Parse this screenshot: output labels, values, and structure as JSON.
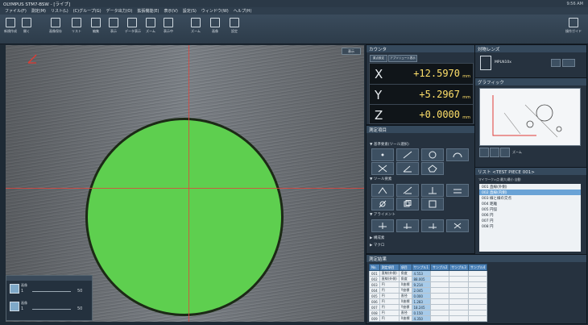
{
  "window": {
    "title": "OLYMPUS STM7-BSW - [ライブ]",
    "clock": "9:56 AM"
  },
  "menu": [
    "ファイル(F)",
    "測定(M)",
    "リスト(L)",
    "(C)グループ(G)",
    "データ出力(O)",
    "拡張機能(E)",
    "表示(V)",
    "設定(S)",
    "ウィンドウ(W)",
    "ヘルプ(H)"
  ],
  "toolbar": {
    "left_tools": [
      "新規作成",
      "開く",
      "画像保存",
      "リスト",
      "編集",
      "表示",
      "データ表示",
      "ズーム",
      "表示中",
      "ズーム",
      "画像",
      "設定"
    ],
    "right_label": "操作ガイド"
  },
  "live": {
    "corner_button": "表示"
  },
  "mini_panel": {
    "rows": [
      {
        "label": "画像",
        "value": "1",
        "end": "50"
      },
      {
        "label": "画像",
        "value": "1",
        "end": "50"
      }
    ]
  },
  "counter": {
    "title": "カウンタ",
    "mode_buttons": [
      "原点設定",
      "アブソリュート表示"
    ],
    "x_label": "X",
    "x_value": "+12.5970",
    "y_label": "Y",
    "y_value": "+5.2967",
    "z_label": "Z",
    "z_value": "+0.0000",
    "unit": "mm"
  },
  "measure": {
    "title": "測定項目",
    "section1": "▼ 基準要素(ツール選択)",
    "section2": "▼ ツール要素",
    "section3": "▼ アライメント",
    "section4": "▶ 構成素",
    "section5": "▶ マクロ"
  },
  "lens": {
    "title": "対物レンズ",
    "lens_name": "MPLN10x"
  },
  "graphics": {
    "title": "グラフィック",
    "zoom_label": "ズーム"
  },
  "list_panel": {
    "title": "リスト <TEST PIECE 001>",
    "subtitle": "マイワーク>点 最大/最小 自動",
    "items": [
      "001 直線(外側)",
      "002 直線(内側)",
      "003 線と線の交点",
      "004 距離",
      "005 円弧",
      "006 円",
      "007 円",
      "008 円"
    ],
    "selected_index": 1
  },
  "results": {
    "title": "測定結果",
    "headers": [
      "No.",
      "測定項目",
      "項目",
      "サンプル1",
      "サンプル2",
      "サンプル3",
      "サンプル4"
    ],
    "rows": [
      [
        "001",
        "直線(外側)",
        "角度",
        "4.553",
        "",
        "",
        ""
      ],
      [
        "002",
        "直線(外側)",
        "角度",
        "88.005",
        "",
        "",
        ""
      ],
      [
        "003",
        "円",
        "X座標",
        "9.214",
        "",
        "",
        ""
      ],
      [
        "004",
        "円",
        "Y座標",
        "2.045",
        "",
        "",
        ""
      ],
      [
        "005",
        "円",
        "直径",
        "0.000",
        "",
        "",
        ""
      ],
      [
        "006",
        "円",
        "X座標",
        "1.283",
        "",
        "",
        ""
      ],
      [
        "007",
        "円",
        "Y座標",
        "18.245",
        "",
        "",
        ""
      ],
      [
        "008",
        "円",
        "直径",
        "0.150",
        "",
        "",
        ""
      ],
      [
        "009",
        "円",
        "X座標",
        "4.350",
        "",
        "",
        ""
      ]
    ]
  }
}
